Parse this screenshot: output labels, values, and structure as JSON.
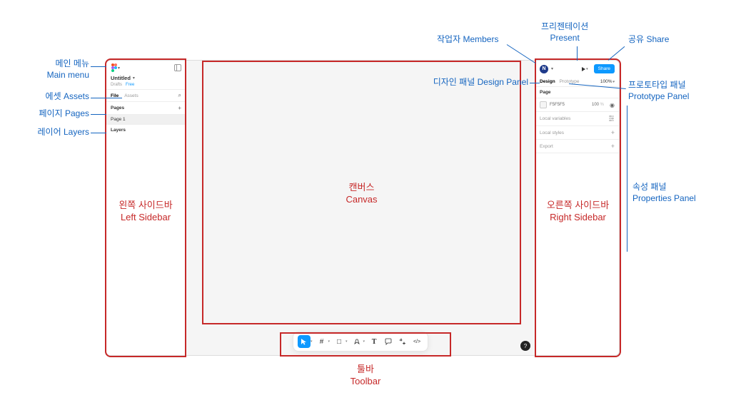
{
  "annotations": {
    "main_menu": {
      "ko": "메인 메뉴",
      "en": "Main menu"
    },
    "assets": {
      "ko": "에셋",
      "en": "Assets"
    },
    "pages": {
      "ko": "페이지",
      "en": "Pages"
    },
    "layers": {
      "ko": "레이어",
      "en": "Layers"
    },
    "left_sidebar": {
      "ko": "왼쪽 사이드바",
      "en": "Left Sidebar"
    },
    "canvas": {
      "ko": "캔버스",
      "en": "Canvas"
    },
    "right_sidebar": {
      "ko": "오른쪽 사이드바",
      "en": "Right Sidebar"
    },
    "toolbar": {
      "ko": "툴바",
      "en": "Toolbar"
    },
    "members": {
      "ko": "작업자",
      "en": "Members"
    },
    "present": {
      "ko": "프리젠테이션",
      "en": "Present"
    },
    "share": {
      "ko": "공유",
      "en": "Share"
    },
    "design_panel": {
      "ko": "디자인 패널",
      "en": "Design Panel"
    },
    "prototype_panel": {
      "ko": "프로토타입 패널",
      "en": "Prototype Panel"
    },
    "properties_panel": {
      "ko": "속성 패널",
      "en": "Properties Panel"
    }
  },
  "left_sidebar": {
    "doc_title": "Untitled",
    "crumb_drafts": "Drafts",
    "crumb_free": "Free",
    "tab_file": "File",
    "tab_assets": "Assets",
    "section_pages": "Pages",
    "page1": "Page 1",
    "section_layers": "Layers"
  },
  "right_sidebar": {
    "avatar_initial": "N",
    "share_label": "Share",
    "tab_design": "Design",
    "tab_prototype": "Prototype",
    "zoom": "100%",
    "page_label": "Page",
    "color_hex": "F5F5F5",
    "color_opacity": "100",
    "color_opacity_unit": "%",
    "local_vars": "Local variables",
    "local_styles": "Local styles",
    "export": "Export"
  },
  "toolbar": {
    "tools": [
      {
        "name": "move-tool",
        "glyph": "▾",
        "svg": "cursor",
        "active": true,
        "caret": true
      },
      {
        "name": "frame-tool",
        "glyph": "#",
        "active": false,
        "caret": true
      },
      {
        "name": "shape-tool",
        "glyph": "□",
        "active": false,
        "caret": true
      },
      {
        "name": "pen-tool",
        "glyph": "✎",
        "active": false,
        "caret": true
      },
      {
        "name": "text-tool",
        "glyph": "T",
        "active": false,
        "caret": false
      },
      {
        "name": "comment-tool",
        "glyph": "💬",
        "active": false,
        "caret": false
      },
      {
        "name": "actions-tool",
        "glyph": "✦",
        "active": false,
        "caret": false
      },
      {
        "name": "dev-tool",
        "glyph": "</>",
        "active": false,
        "caret": false
      }
    ]
  },
  "help_label": "?"
}
